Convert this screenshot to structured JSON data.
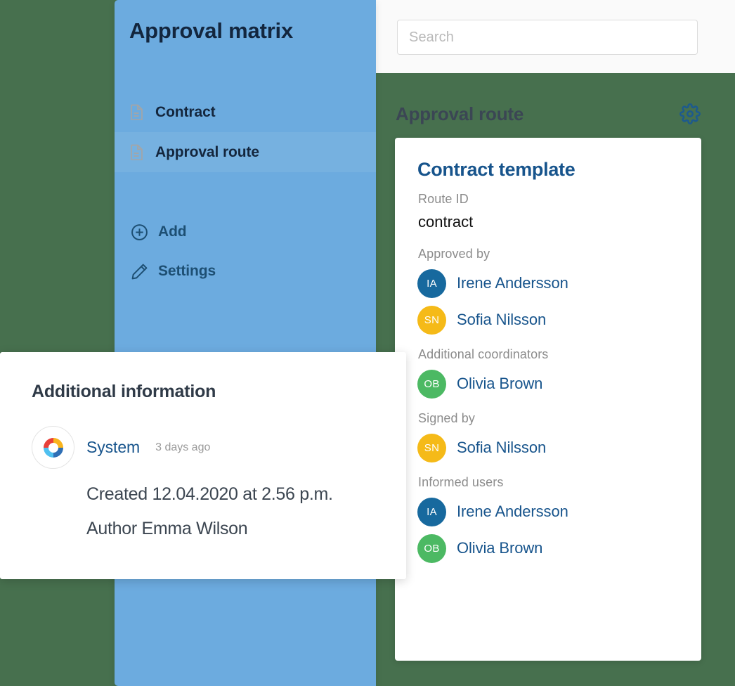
{
  "background": {
    "page_color": "#47704e"
  },
  "search": {
    "placeholder": "Search",
    "icon": "search-input"
  },
  "sidebar": {
    "title": "Approval matrix",
    "color": "#6cabdf",
    "nav_items": [
      {
        "label": "Contract",
        "icon": "document-icon",
        "active": false
      },
      {
        "label": "Approval route",
        "icon": "document-icon",
        "active": true
      }
    ],
    "actions": [
      {
        "label": "Add",
        "icon": "plus-circle-icon"
      },
      {
        "label": "Settings",
        "icon": "pencil-icon"
      }
    ]
  },
  "route_panel": {
    "title": "Approval route",
    "settings_icon": "gear-icon",
    "card": {
      "title": "Contract template",
      "route_id_label": "Route ID",
      "route_id_value": "contract",
      "groups": [
        {
          "label": "Approved by",
          "people": [
            {
              "initials": "IA",
              "name": "Irene Andersson",
              "color": "#17699e"
            },
            {
              "initials": "SN",
              "name": "Sofia Nilsson",
              "color": "#f5ba18"
            }
          ]
        },
        {
          "label": "Additional coordinators",
          "people": [
            {
              "initials": "OB",
              "name": "Olivia Brown",
              "color": "#4cb963"
            }
          ]
        },
        {
          "label": "Signed by",
          "people": [
            {
              "initials": "SN",
              "name": "Sofia Nilsson",
              "color": "#f5ba18"
            }
          ]
        },
        {
          "label": "Informed users",
          "people": [
            {
              "initials": "IA",
              "name": "Irene Andersson",
              "color": "#17699e"
            },
            {
              "initials": "OB",
              "name": "Olivia Brown",
              "color": "#4cb963"
            }
          ]
        }
      ]
    }
  },
  "info_card": {
    "title": "Additional information",
    "author": "System",
    "timestamp": "3 days ago",
    "logo_icon": "system-logo-icon",
    "lines": [
      "Created 12.04.2020 at 2.56 p.m.",
      "Author Emma Wilson"
    ]
  }
}
